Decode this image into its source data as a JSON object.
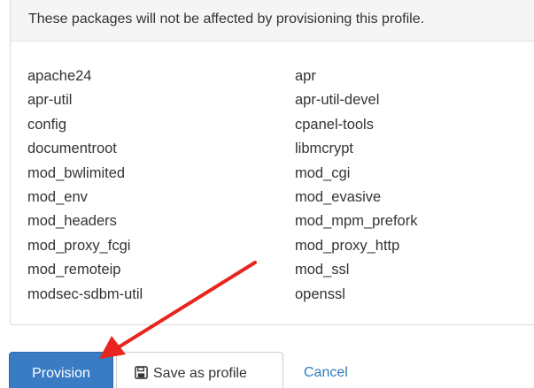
{
  "panel": {
    "header_text": "These packages will not be affected by provisioning this profile."
  },
  "packages": [
    "apache24",
    "apr",
    "apr-util",
    "apr-util-devel",
    "config",
    "cpanel-tools",
    "documentroot",
    "libmcrypt",
    "mod_bwlimited",
    "mod_cgi",
    "mod_env",
    "mod_evasive",
    "mod_headers",
    "mod_mpm_prefork",
    "mod_proxy_fcgi",
    "mod_proxy_http",
    "mod_remoteip",
    "mod_ssl",
    "modsec-sdbm-util",
    "openssl"
  ],
  "actions": {
    "provision_label": "Provision",
    "save_label": "Save as profile",
    "cancel_label": "Cancel"
  },
  "colors": {
    "primary_button": "#3a7cc4",
    "link": "#2f7abf",
    "annotation_arrow": "#e8261f"
  }
}
